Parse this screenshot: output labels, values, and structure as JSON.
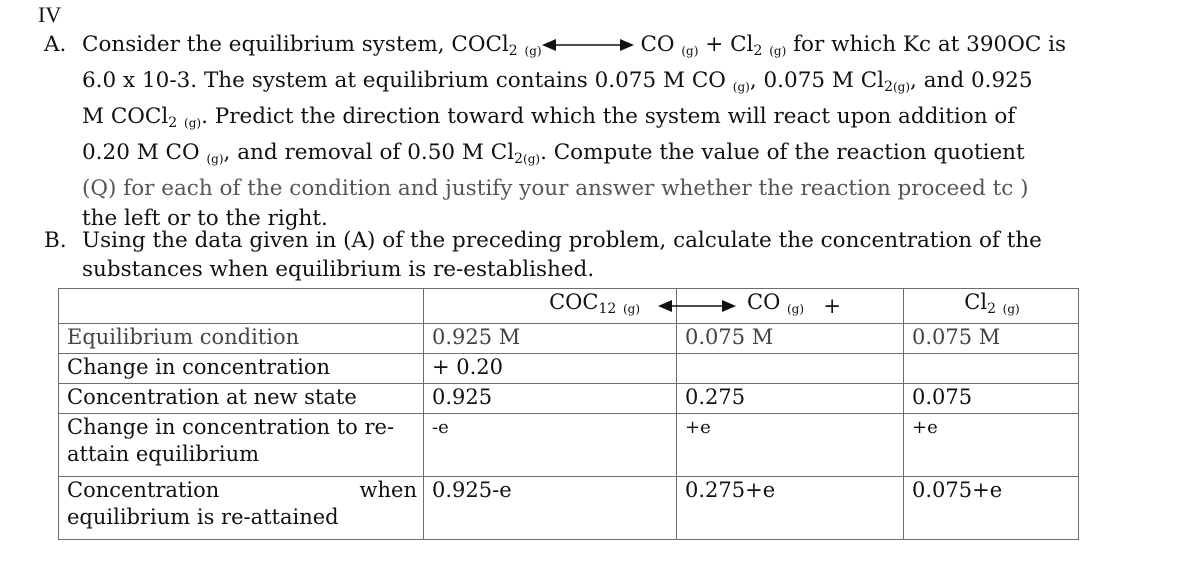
{
  "section_label": "IV",
  "part_a": {
    "label": "A.",
    "line1_pre": "Consider the equilibrium system, COCl",
    "line1_sub2": "2",
    "phase": "(g)",
    "line1_mid": "CO",
    "line1_plus": "+ Cl",
    "line1_post": "for which Kc at 390OC is",
    "line2": "6.0 x 10-3. The system at equilibrium contains 0.075 M CO",
    "line2_b": ", 0.075 M Cl",
    "line2_c": ", and 0.925",
    "line3_pre": "M COCl",
    "line3_post": ". Predict the direction toward which the system will react upon addition of",
    "line4_pre": "0.20 M CO",
    "line4_mid": ", and removal of 0.50 M Cl",
    "line4_post": ". Compute the value of the reaction quotient",
    "line5": "(Q) for each of the condition and justify your answer whether the reaction proceed tc )",
    "line6": "the left or to the right."
  },
  "part_b": {
    "label": "B.",
    "line1": "Using the data given in (A) of the preceding problem, calculate the concentration of the",
    "line2": "substances when equilibrium is re-established."
  },
  "ice_table": {
    "headers": {
      "reactant": "COC",
      "reactant_sub": "12",
      "phase": "(g)",
      "product1": "CO",
      "plus": "+",
      "product2": "Cl",
      "product2_sub": "2"
    },
    "rows": [
      {
        "label": "Equilibrium condition",
        "coc": "0.925 M",
        "co": "0.075 M",
        "cl": "0.075 M"
      },
      {
        "label": "Change in concentration",
        "coc": "+ 0.20",
        "co": "",
        "cl": ""
      },
      {
        "label": "Concentration at new state",
        "coc": "0.925",
        "co": "0.275",
        "cl": "0.075"
      },
      {
        "label": "Change in concentration to re-attain equilibrium",
        "coc": "-e",
        "co": "+e",
        "cl": "+e"
      },
      {
        "label_a": "Concentration",
        "label_b": "when",
        "label_c": "equilibrium is re-attained",
        "coc": "0.925-e",
        "co": "0.275+e",
        "cl": "0.075+e"
      }
    ]
  }
}
